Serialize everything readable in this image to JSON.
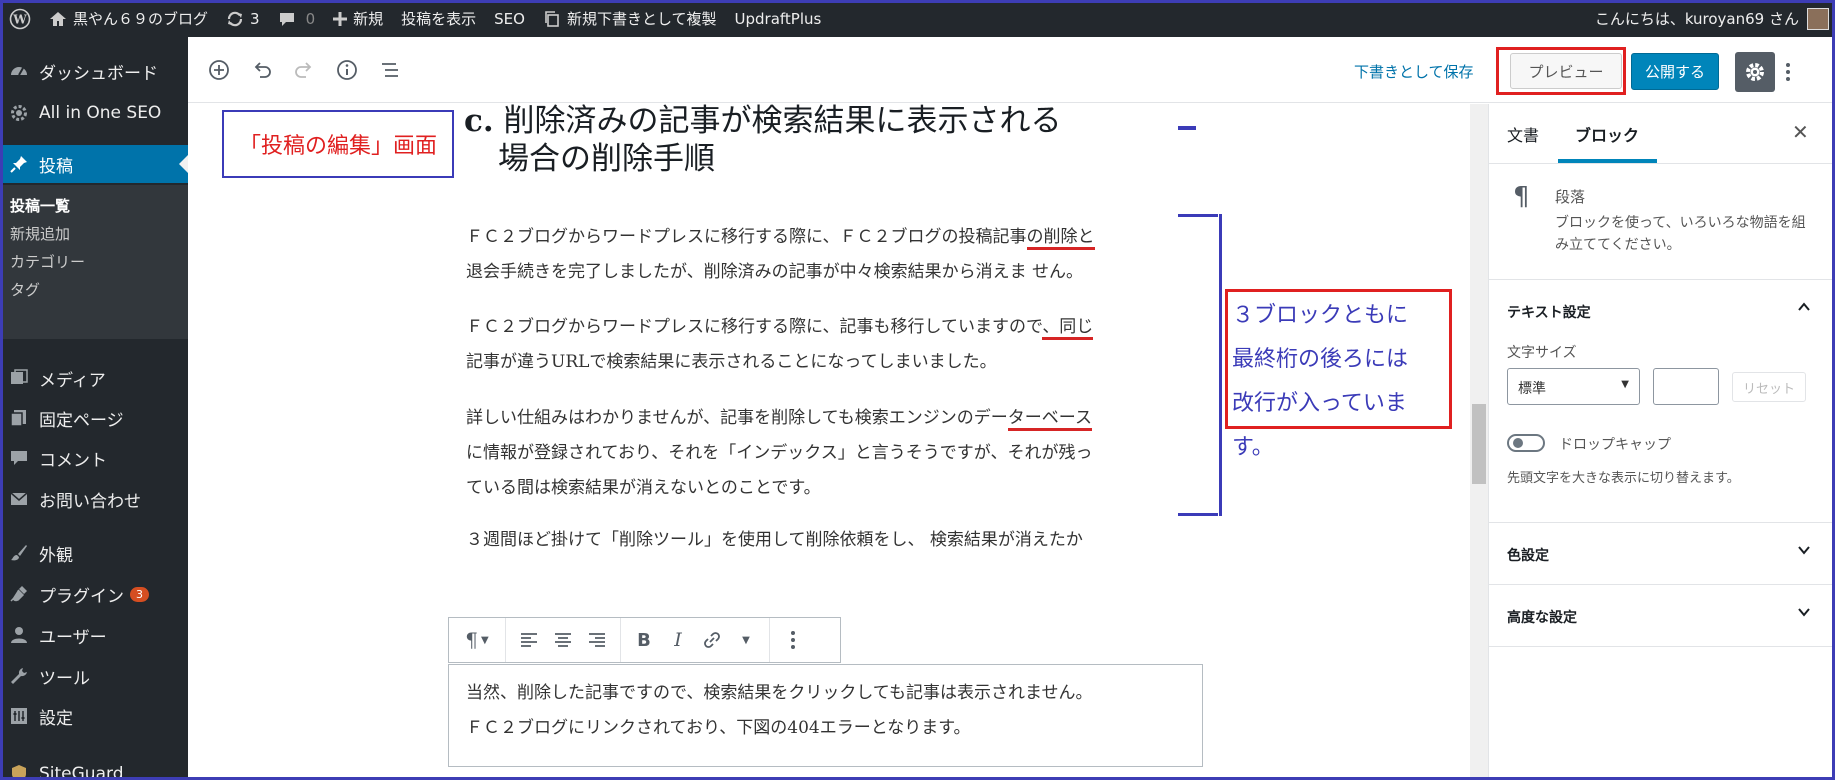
{
  "adminbar": {
    "site_name": "黒やん６９のブログ",
    "updates_count": "3",
    "comments_count": "0",
    "new_label": "新規",
    "view_post": "投稿を表示",
    "seo": "SEO",
    "duplicate_draft": "新規下書きとして複製",
    "updraft": "UpdraftPlus",
    "greeting": "こんにちは、kuroyan69 さん"
  },
  "sidebar": {
    "items": [
      {
        "label": "ダッシュボード",
        "icon": "dashboard-icon"
      },
      {
        "label": "All in One SEO",
        "icon": "gear-icon"
      },
      {
        "label": "投稿",
        "icon": "pin-icon"
      },
      {
        "label": "メディア",
        "icon": "media-icon"
      },
      {
        "label": "固定ページ",
        "icon": "pages-icon"
      },
      {
        "label": "コメント",
        "icon": "comment-icon"
      },
      {
        "label": "お問い合わせ",
        "icon": "mail-icon"
      },
      {
        "label": "外観",
        "icon": "brush-icon"
      },
      {
        "label": "プラグイン",
        "icon": "plugin-icon",
        "badge": "3"
      },
      {
        "label": "ユーザー",
        "icon": "user-icon"
      },
      {
        "label": "ツール",
        "icon": "wrench-icon"
      },
      {
        "label": "設定",
        "icon": "settings-icon"
      },
      {
        "label": "SiteGuard",
        "icon": "shield-icon"
      }
    ],
    "submenu": [
      "投稿一覧",
      "新規追加",
      "カテゴリー",
      "タグ"
    ]
  },
  "header": {
    "save_draft": "下書きとして保存",
    "preview": "プレビュー",
    "publish": "公開する"
  },
  "content": {
    "heading_label": "c.",
    "heading_line1": "削除済みの記事が検索結果に表示される",
    "heading_line2": "場合の削除手順",
    "p1_a": "ＦＣ２ブログからワードプレスに移行する際に、ＦＣ２ブログの投稿記事",
    "p1_b": "の削除と",
    "p1_c": "退会手続きを完了しましたが、削除済みの記事が中々検索結果から消えま せん。",
    "p2_a": "ＦＣ２ブログからワードプレスに移行する際に、記事も移行していますので",
    "p2_b": "、同じ",
    "p2_c": "記事が違うURLで検索結果に表示されることになってしまいました。",
    "p3_a": "詳しい仕組みはわかりませんが、記事を削除しても検索エンジンのデー",
    "p3_b": "ターベース",
    "p3_c": "に情報が登録されており、それを「インデックス」と言うそうですが、それが残っ",
    "p3_d": "ている間は検索結果が消えないとのことです。",
    "p4_a": "３週間ほど掛けて「削除ツール」を使用して削除依頼をし、 検索結果が消えたか",
    "p5_a": "当然、削除した記事ですので、検索結果をクリックしても記事は表示されません。",
    "p5_b": "ＦＣ２ブログにリンクされており、下図の404エラーとなります。"
  },
  "annotations": {
    "edit_screen": "「投稿の編集」画面",
    "note_line1": "３ブロックともに",
    "note_line2": "最終桁の後ろには",
    "note_line3": "改行が入っています。"
  },
  "panel": {
    "tab_document": "文書",
    "tab_block": "ブロック",
    "block_name": "段落",
    "block_desc": "ブロックを使って、いろいろな物語を組み立ててください。",
    "text_settings": "テキスト設定",
    "font_size_label": "文字サイズ",
    "font_size_value": "標準",
    "reset": "リセット",
    "drop_cap": "ドロップキャップ",
    "drop_cap_help": "先頭文字を大きな表示に切り替えます。",
    "color_settings": "色設定",
    "advanced": "高度な設定"
  },
  "colors": {
    "admin_bg": "#23282d",
    "accent": "#0085ba",
    "annotation_red": "#e02020",
    "annotation_blue": "#3b3bb8"
  }
}
